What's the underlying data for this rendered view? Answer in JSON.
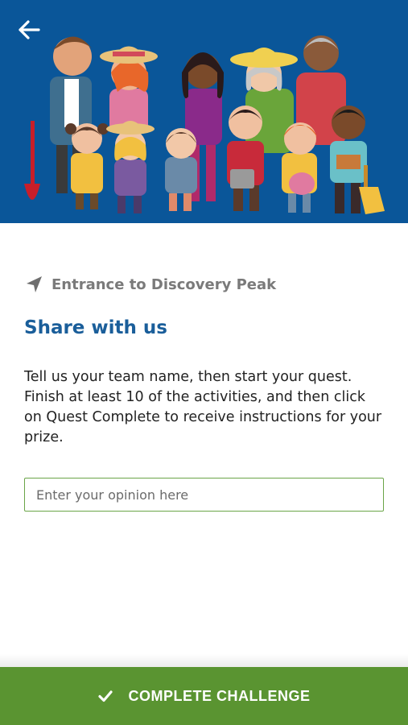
{
  "header": {
    "back_icon": "back-arrow-icon",
    "illustration": "group-of-gardeners-illustration",
    "background_color": "#0a5699"
  },
  "location": {
    "icon": "navigation-arrow-icon",
    "label": "Entrance to Discovery Peak"
  },
  "challenge": {
    "title": "Share with us",
    "description": "Tell us your team name, then start your quest. Finish at least 10 of the activities, and then click on Quest Complete to receive instructions for your prize."
  },
  "opinion_input": {
    "value": "",
    "placeholder": "Enter your opinion here"
  },
  "footer": {
    "button_icon": "checkmark-icon",
    "button_label": "COMPLETE CHALLENGE",
    "button_color": "#5a9431"
  },
  "colors": {
    "title": "#1a5e9a",
    "input_border": "#6aa548"
  }
}
